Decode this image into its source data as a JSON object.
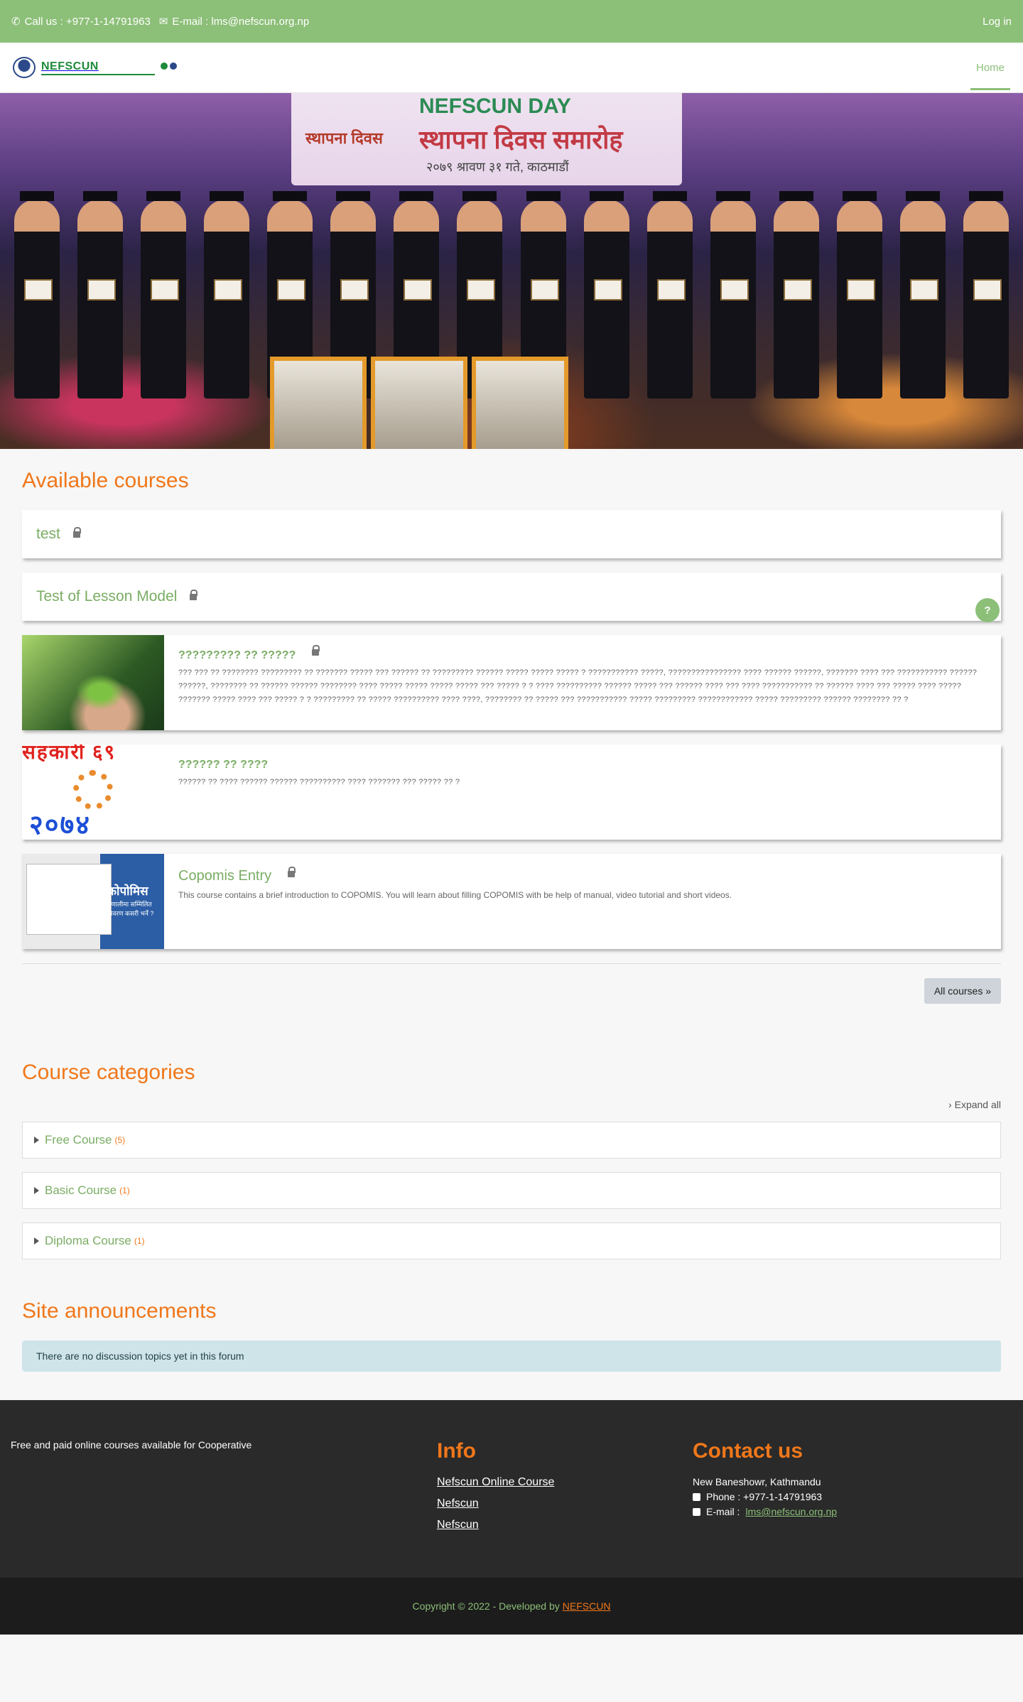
{
  "topbar": {
    "phone": "Call us : +977-1-14791963",
    "email": "E-mail : lms@nefscun.org.np",
    "login": "Log in"
  },
  "navbar": {
    "logo_name": "NEFSCUN",
    "home": "Home"
  },
  "hero": {
    "banner_line1": "NEFSCUN DAY",
    "banner_line2": "स्थापना दिवस समारोह",
    "banner_line3": "२०७९ श्रावण ३१ गते, काठमाडौं",
    "banner_left": "स्थापना दिवस"
  },
  "available": {
    "title": "Available courses",
    "simple": [
      {
        "name": "test"
      },
      {
        "name": "Test of Lesson Model"
      }
    ],
    "rich": [
      {
        "name": "????????? ?? ?????",
        "summary": "??? ??? ?? ???????? ????????? ?? ??????? ????? ??? ?????? ?? ????????? ?????? ????? ????? ????? ? ??????????? ?????, ???????????????? ???? ?????? ??????, ??????? ???? ??? ??????????? ?????? ??????, ???????? ?? ?????? ?????? ???????? ???? ????? ????? ????? ????? ??? ????? ? ? ???? ?????????? ?????? ????? ??? ?????? ???? ??? ???? ??????????? ?? ?????? ???? ??? ????? ???? ????? ??????? ????? ???? ??? ????? ? ? ????????? ?? ????? ?????????? ???? ????, ???????? ?? ????? ??? ??????????? ????? ????????? ???????????? ????? ????????? ?????? ???????? ?? ?"
      },
      {
        "name": "?????? ?? ????",
        "summary": "?????? ?? ???? ?????? ?????? ?????????? ???? ??????? ??? ????? ?? ?"
      },
      {
        "name": "Copomis Entry",
        "summary": "This course contains a brief introduction to COPOMIS. You will learn about filling COPOMIS with be help of manual, video tutorial and short videos."
      }
    ],
    "thumb_lamp_top": "सहकारी ६९",
    "thumb_lamp_bottom": "२०७४",
    "thumb_copomis_title": "कोपोमिस",
    "thumb_copomis_sub": "प्रणालीमा सम्मिलित विवरण कसरी भर्ने ?",
    "all_courses": "All courses »"
  },
  "categories": {
    "title": "Course categories",
    "expand": "Expand all",
    "items": [
      {
        "name": "Free Course",
        "count": "(5)"
      },
      {
        "name": "Basic Course",
        "count": "(1)"
      },
      {
        "name": "Diploma Course",
        "count": "(1)"
      }
    ]
  },
  "announcements": {
    "title": "Site announcements",
    "empty": "There are no discussion topics yet in this forum"
  },
  "footer": {
    "tagline": "Free and paid online courses available for Cooperative",
    "info_title": "Info",
    "links": [
      "Nefscun Online Course",
      "Nefscun",
      "Nefscun"
    ],
    "contact_title": "Contact us",
    "address": "New Baneshowr, Kathmandu",
    "phone": "Phone : +977-1-14791963",
    "email_label": "E-mail :",
    "email": "lms@nefscun.org.np",
    "copyright": "Copyright © 2022 - Developed by",
    "developer": "NEFSCUN"
  },
  "colors": {
    "accent_green": "#8cbf78",
    "accent_orange": "#f0771a"
  }
}
